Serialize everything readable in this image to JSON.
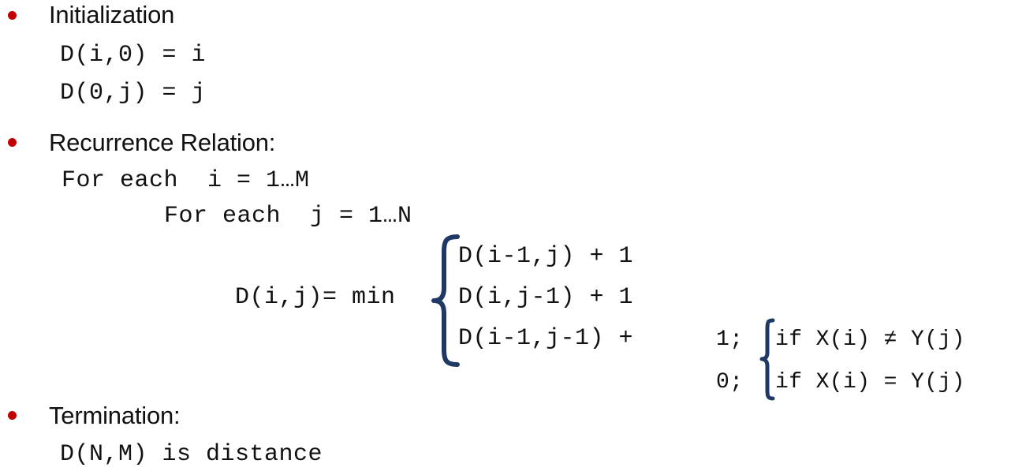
{
  "slide": {
    "background_color": "#FFFFFF",
    "bullet_color": "#C00000",
    "brace_color": "#1F3864",
    "text_color": "#111111"
  },
  "sections": [
    {
      "heading": "Initialization",
      "lines": [
        "D(i,0) = i",
        "D(0,j) = j"
      ]
    },
    {
      "heading": "Recurrence Relation:",
      "lines": [
        "For each  i = 1…M",
        "For each  j = 1…N"
      ]
    },
    {
      "heading": "Termination:",
      "lines": [
        "D(N,M) is distance"
      ]
    }
  ],
  "recurrence": {
    "lhs": "D(i,j)= min",
    "options": [
      "D(i-1,j) + 1",
      "D(i,j-1) + 1",
      "D(i-1,j-1) +"
    ],
    "costs": [
      {
        "value": "1;",
        "condition": "if X(i) ≠ Y(j)"
      },
      {
        "value": "0;",
        "condition": "if X(i) = Y(j)"
      }
    ]
  },
  "icons": {
    "bullet": "bullet-dot",
    "large_brace": "curly-brace-large",
    "small_brace": "curly-brace-small"
  }
}
